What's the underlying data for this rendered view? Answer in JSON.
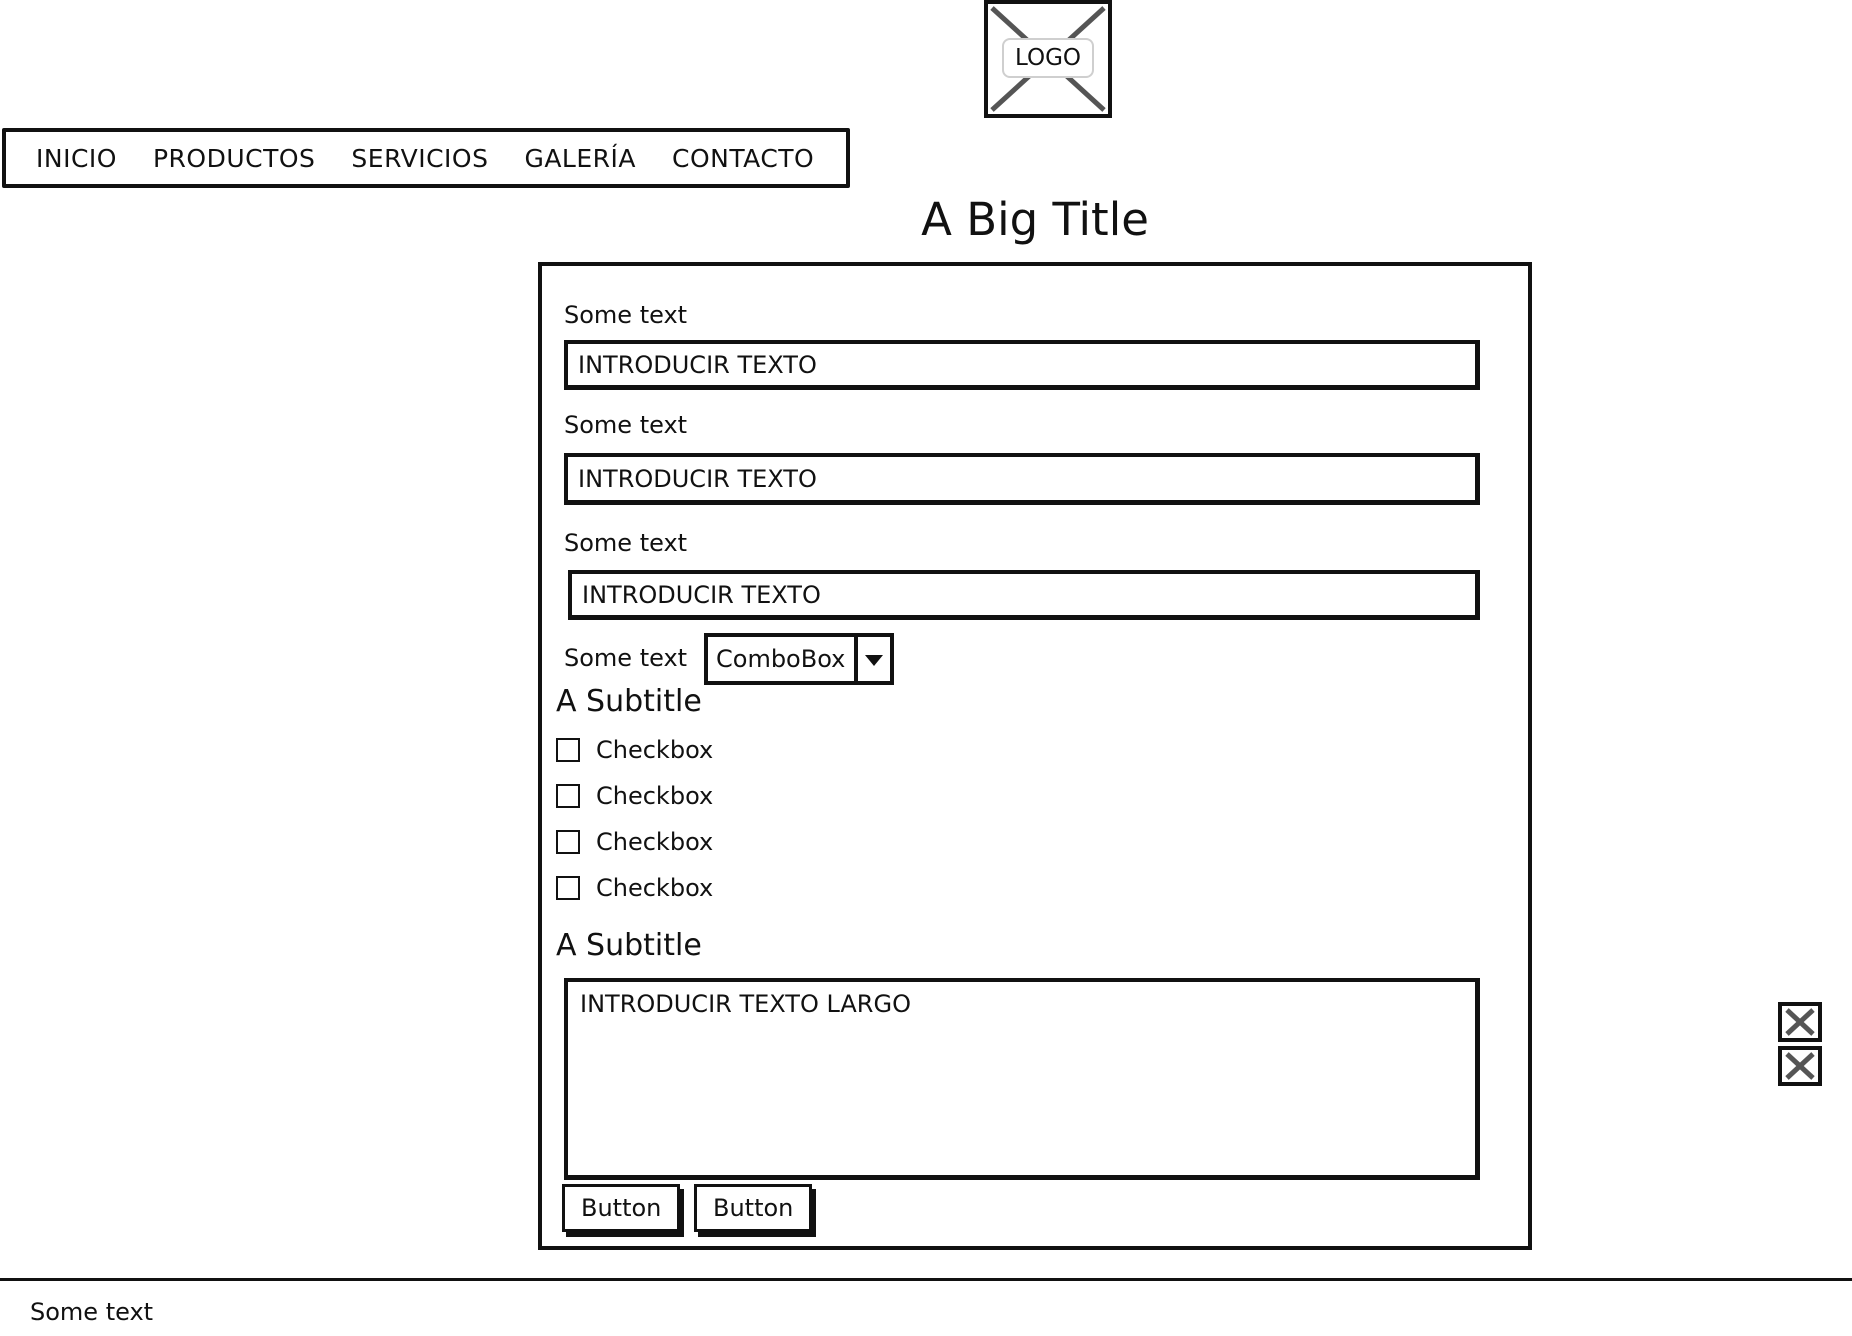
{
  "logo": {
    "label": "LOGO"
  },
  "nav": {
    "items": [
      {
        "label": "INICIO"
      },
      {
        "label": "PRODUCTOS"
      },
      {
        "label": "SERVICIOS"
      },
      {
        "label": "GALERÍA"
      },
      {
        "label": "CONTACTO"
      }
    ]
  },
  "page_title": "A Big Title",
  "form": {
    "fields": [
      {
        "label": "Some text",
        "placeholder": "INTRODUCIR TEXTO"
      },
      {
        "label": "Some text",
        "placeholder": "INTRODUCIR TEXTO"
      },
      {
        "label": "Some text",
        "placeholder": "INTRODUCIR TEXTO"
      }
    ],
    "combo": {
      "label": "Some text",
      "value": "ComboBox"
    },
    "section1_subtitle": "A Subtitle",
    "checkboxes": [
      {
        "label": "Checkbox",
        "checked": false
      },
      {
        "label": "Checkbox",
        "checked": false
      },
      {
        "label": "Checkbox",
        "checked": false
      },
      {
        "label": "Checkbox",
        "checked": false
      }
    ],
    "section2_subtitle": "A Subtitle",
    "long_text_placeholder": "INTRODUCIR TEXTO LARGO",
    "buttons": [
      {
        "label": "Button"
      },
      {
        "label": "Button"
      }
    ]
  },
  "side_icons": [
    "close-icon",
    "close-icon"
  ],
  "footer": {
    "text": "Some text"
  }
}
